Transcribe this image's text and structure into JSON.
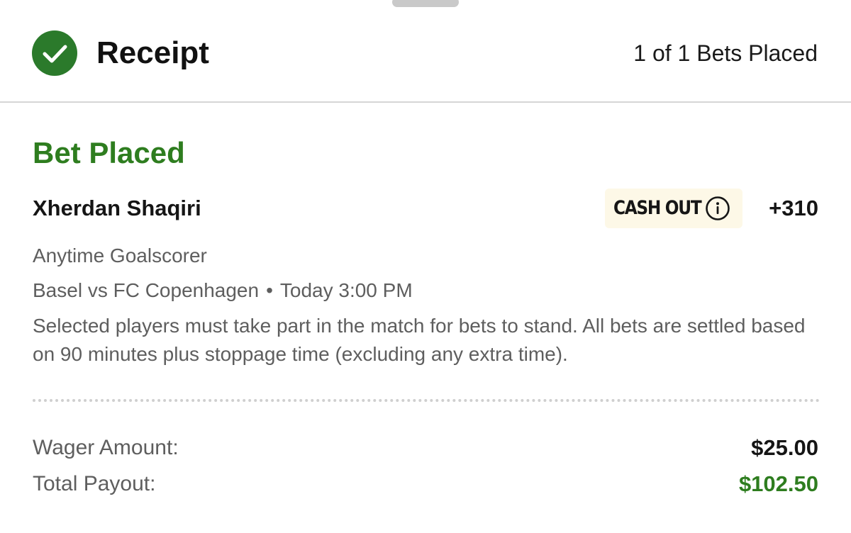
{
  "header": {
    "title": "Receipt",
    "bets_count": "1 of 1 Bets Placed"
  },
  "bet": {
    "status": "Bet Placed",
    "player": "Xherdan Shaqiri",
    "cashout_label": "CASH OUT",
    "odds": "+310",
    "market": "Anytime Goalscorer",
    "match": "Basel vs FC Copenhagen",
    "separator": "•",
    "kickoff": "Today 3:00 PM",
    "disclaimer": "Selected players must take part in the match for bets to stand. All bets are settled based on 90 minutes plus stoppage time (excluding any extra time)."
  },
  "summary": {
    "wager_label": "Wager Amount:",
    "wager_value": "$25.00",
    "payout_label": "Total Payout:",
    "payout_value": "$102.50"
  },
  "icons": {
    "status": "check-icon",
    "info": "info-icon"
  },
  "colors": {
    "success_green": "#2e7d1f",
    "check_circle": "#2b7a2b",
    "cashout_bg": "#fdf8e7"
  }
}
